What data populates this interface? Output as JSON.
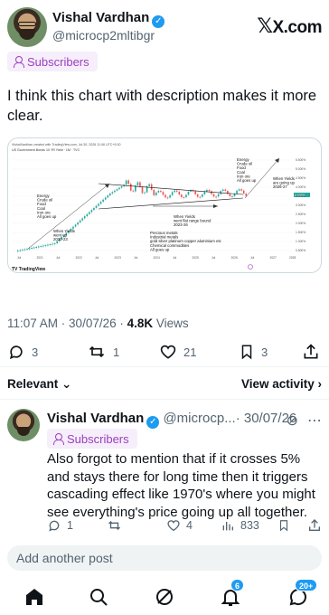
{
  "post": {
    "author_name": "Vishal Vardhan",
    "author_handle": "@microcp2mltibgr",
    "brand": "X.com",
    "subscribers_label": "Subscribers",
    "text": "I think this chart with description makes it more clear.",
    "time": "11:07 AM",
    "date": "30/07/26",
    "views_count": "4.8K",
    "views_label": "Views",
    "replies": "3",
    "reposts": "1",
    "likes": "21",
    "bookmarks": "3"
  },
  "chart_image": {
    "header_line": "VishalVardhan created with TradingView.com, Jul 30, 2026 11:06 UTC+5:30",
    "series_title": "US Government Bonds 10 YR Yield · 1M · TVC",
    "watermark": "TradingView",
    "y_ticks": [
      "5.500%",
      "5.000%",
      "4.500%",
      "4.000%",
      "3.500%",
      "3.000%",
      "2.500%",
      "2.000%",
      "1.500%",
      "1.000%",
      "0.500%"
    ],
    "x_ticks": [
      "Jul",
      "2021",
      "Jul",
      "2022",
      "Jul",
      "2023",
      "Jul",
      "2024",
      "Jul",
      "2025",
      "Jul",
      "2026",
      "Jul",
      "2027",
      "2028"
    ],
    "last_price_label": "4.346%",
    "annotations": {
      "left": [
        "Energy",
        "Crude oil",
        "Food",
        "Coal",
        "Iron ore",
        "All goes up"
      ],
      "left_yields": [
        "When Yields",
        "went up",
        "2020-23"
      ],
      "middle_yields": [
        "When Yields",
        "went flat range bound",
        "2023-26"
      ],
      "middle_metals": [
        "Precious metals",
        "Industrial metals",
        "gold silver platinum copper aluminium etc",
        "Chemical commodities",
        "All goes up"
      ],
      "right": [
        "Energy",
        "Crude oil",
        "Food",
        "Coal",
        "Iron ore",
        "All goes up"
      ],
      "right_yields": [
        "When Yields",
        "are going up",
        "2026-27"
      ]
    },
    "colors": {
      "up": "#26a69a",
      "down": "#ef5350"
    }
  },
  "tabs": {
    "relevant": "Relevant",
    "view_activity": "View activity"
  },
  "reply": {
    "author_name": "Vishal Vardhan",
    "author_handle": "@microcp...",
    "date": "· 30/07/26",
    "subscribers_label": "Subscribers",
    "text": "Also forgot to mention that if it crosses 5%  and stays there for long time then it triggers cascading effect like 1970's where you might see everything's price going up all together.",
    "replies": "1",
    "likes": "4",
    "views": "833"
  },
  "composer": {
    "placeholder": "Add another post"
  },
  "nav": {
    "notifications_badge": "6",
    "messages_badge": "20+"
  },
  "colors": {
    "accent": "#1d9bf0",
    "subscriber_purple": "#9b3fbf",
    "muted": "#536471"
  }
}
